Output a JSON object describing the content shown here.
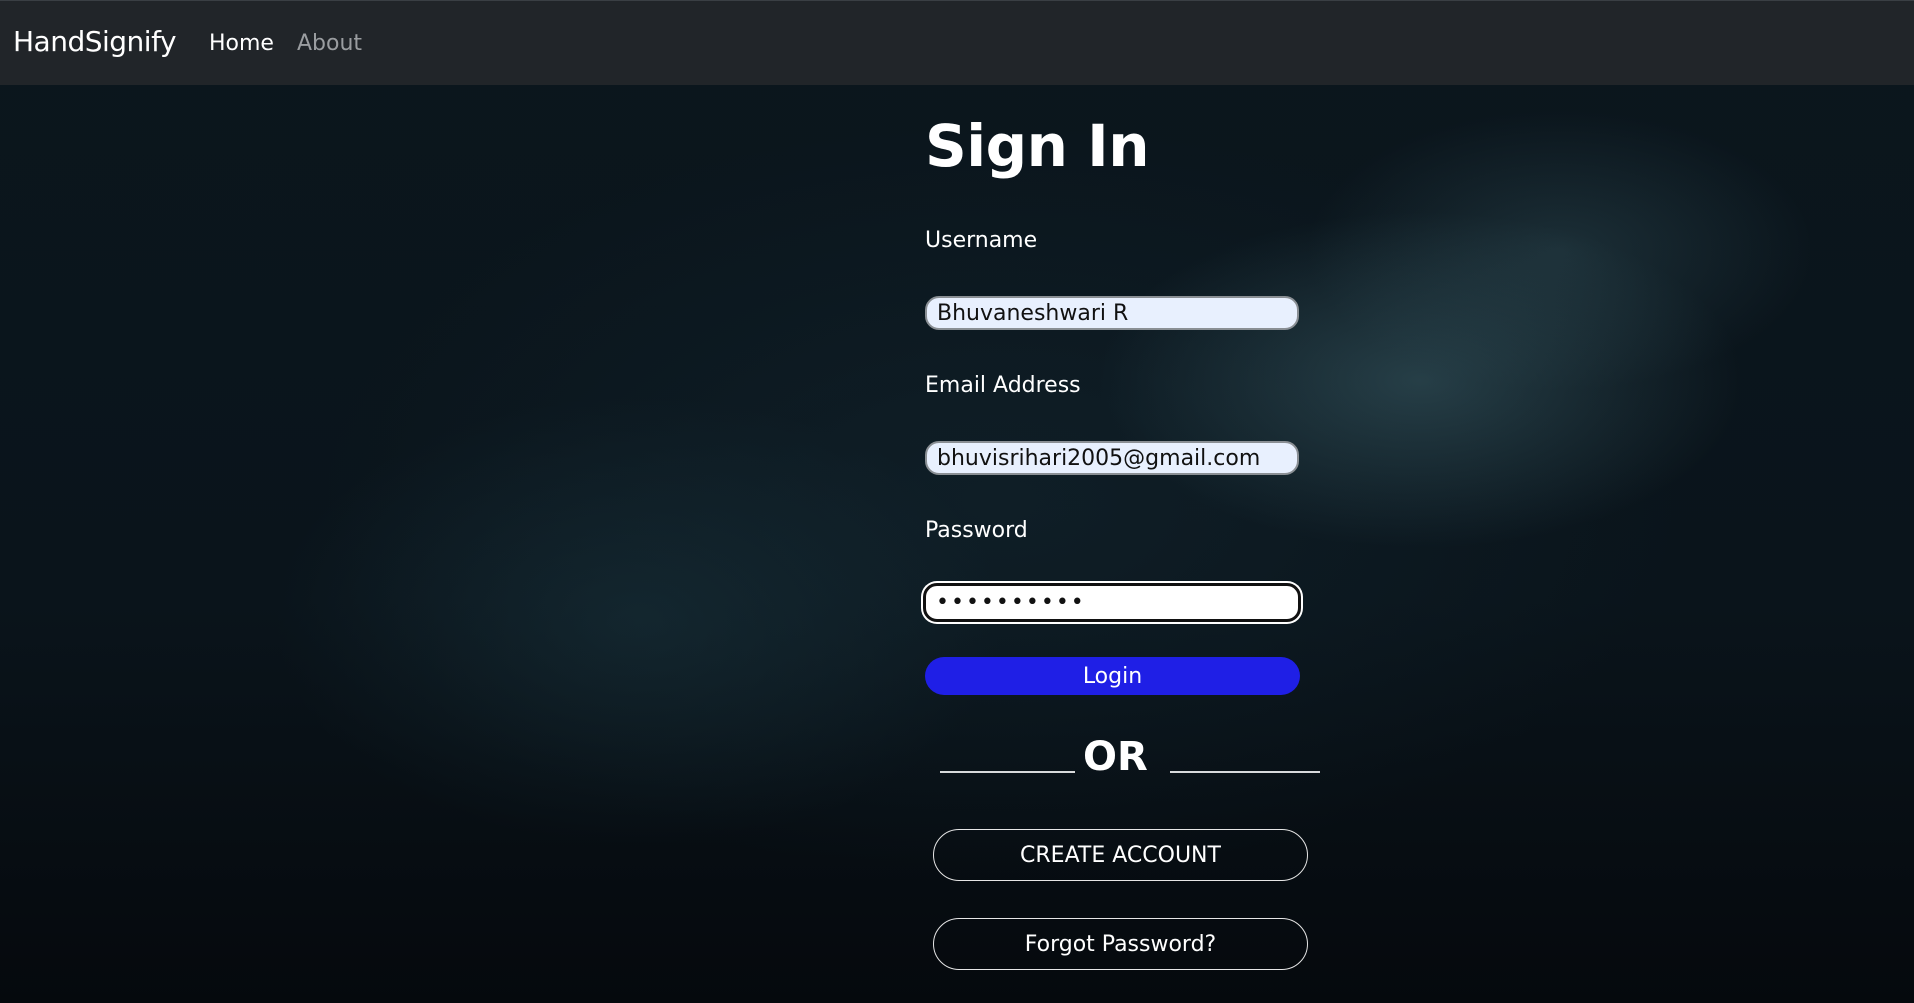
{
  "navbar": {
    "brand": "HandSignify",
    "links": [
      "Home",
      "About"
    ]
  },
  "form": {
    "title": "Sign In",
    "username_label": "Username",
    "username_value": "Bhuvaneshwari R",
    "email_label": "Email Address",
    "email_value": "bhuvisrihari2005@gmail.com",
    "password_label": "Password",
    "password_value": "••••••••••",
    "login_label": "Login",
    "or_text": "OR",
    "create_account_label": "CREATE ACCOUNT",
    "forgot_password_label": "Forgot Password?"
  },
  "colors": {
    "navbar_bg": "#212529",
    "login_button": "#1f1fe6",
    "autofill_bg": "#e8f0fe"
  }
}
